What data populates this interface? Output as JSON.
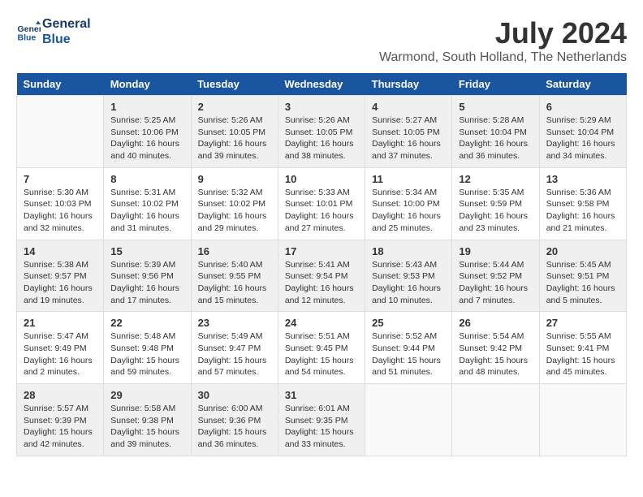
{
  "logo": {
    "line1": "General",
    "line2": "Blue"
  },
  "title": "July 2024",
  "location": "Warmond, South Holland, The Netherlands",
  "weekdays": [
    "Sunday",
    "Monday",
    "Tuesday",
    "Wednesday",
    "Thursday",
    "Friday",
    "Saturday"
  ],
  "weeks": [
    [
      {
        "day": "",
        "info": ""
      },
      {
        "day": "1",
        "info": "Sunrise: 5:25 AM\nSunset: 10:06 PM\nDaylight: 16 hours\nand 40 minutes."
      },
      {
        "day": "2",
        "info": "Sunrise: 5:26 AM\nSunset: 10:05 PM\nDaylight: 16 hours\nand 39 minutes."
      },
      {
        "day": "3",
        "info": "Sunrise: 5:26 AM\nSunset: 10:05 PM\nDaylight: 16 hours\nand 38 minutes."
      },
      {
        "day": "4",
        "info": "Sunrise: 5:27 AM\nSunset: 10:05 PM\nDaylight: 16 hours\nand 37 minutes."
      },
      {
        "day": "5",
        "info": "Sunrise: 5:28 AM\nSunset: 10:04 PM\nDaylight: 16 hours\nand 36 minutes."
      },
      {
        "day": "6",
        "info": "Sunrise: 5:29 AM\nSunset: 10:04 PM\nDaylight: 16 hours\nand 34 minutes."
      }
    ],
    [
      {
        "day": "7",
        "info": "Sunrise: 5:30 AM\nSunset: 10:03 PM\nDaylight: 16 hours\nand 32 minutes."
      },
      {
        "day": "8",
        "info": "Sunrise: 5:31 AM\nSunset: 10:02 PM\nDaylight: 16 hours\nand 31 minutes."
      },
      {
        "day": "9",
        "info": "Sunrise: 5:32 AM\nSunset: 10:02 PM\nDaylight: 16 hours\nand 29 minutes."
      },
      {
        "day": "10",
        "info": "Sunrise: 5:33 AM\nSunset: 10:01 PM\nDaylight: 16 hours\nand 27 minutes."
      },
      {
        "day": "11",
        "info": "Sunrise: 5:34 AM\nSunset: 10:00 PM\nDaylight: 16 hours\nand 25 minutes."
      },
      {
        "day": "12",
        "info": "Sunrise: 5:35 AM\nSunset: 9:59 PM\nDaylight: 16 hours\nand 23 minutes."
      },
      {
        "day": "13",
        "info": "Sunrise: 5:36 AM\nSunset: 9:58 PM\nDaylight: 16 hours\nand 21 minutes."
      }
    ],
    [
      {
        "day": "14",
        "info": "Sunrise: 5:38 AM\nSunset: 9:57 PM\nDaylight: 16 hours\nand 19 minutes."
      },
      {
        "day": "15",
        "info": "Sunrise: 5:39 AM\nSunset: 9:56 PM\nDaylight: 16 hours\nand 17 minutes."
      },
      {
        "day": "16",
        "info": "Sunrise: 5:40 AM\nSunset: 9:55 PM\nDaylight: 16 hours\nand 15 minutes."
      },
      {
        "day": "17",
        "info": "Sunrise: 5:41 AM\nSunset: 9:54 PM\nDaylight: 16 hours\nand 12 minutes."
      },
      {
        "day": "18",
        "info": "Sunrise: 5:43 AM\nSunset: 9:53 PM\nDaylight: 16 hours\nand 10 minutes."
      },
      {
        "day": "19",
        "info": "Sunrise: 5:44 AM\nSunset: 9:52 PM\nDaylight: 16 hours\nand 7 minutes."
      },
      {
        "day": "20",
        "info": "Sunrise: 5:45 AM\nSunset: 9:51 PM\nDaylight: 16 hours\nand 5 minutes."
      }
    ],
    [
      {
        "day": "21",
        "info": "Sunrise: 5:47 AM\nSunset: 9:49 PM\nDaylight: 16 hours\nand 2 minutes."
      },
      {
        "day": "22",
        "info": "Sunrise: 5:48 AM\nSunset: 9:48 PM\nDaylight: 15 hours\nand 59 minutes."
      },
      {
        "day": "23",
        "info": "Sunrise: 5:49 AM\nSunset: 9:47 PM\nDaylight: 15 hours\nand 57 minutes."
      },
      {
        "day": "24",
        "info": "Sunrise: 5:51 AM\nSunset: 9:45 PM\nDaylight: 15 hours\nand 54 minutes."
      },
      {
        "day": "25",
        "info": "Sunrise: 5:52 AM\nSunset: 9:44 PM\nDaylight: 15 hours\nand 51 minutes."
      },
      {
        "day": "26",
        "info": "Sunrise: 5:54 AM\nSunset: 9:42 PM\nDaylight: 15 hours\nand 48 minutes."
      },
      {
        "day": "27",
        "info": "Sunrise: 5:55 AM\nSunset: 9:41 PM\nDaylight: 15 hours\nand 45 minutes."
      }
    ],
    [
      {
        "day": "28",
        "info": "Sunrise: 5:57 AM\nSunset: 9:39 PM\nDaylight: 15 hours\nand 42 minutes."
      },
      {
        "day": "29",
        "info": "Sunrise: 5:58 AM\nSunset: 9:38 PM\nDaylight: 15 hours\nand 39 minutes."
      },
      {
        "day": "30",
        "info": "Sunrise: 6:00 AM\nSunset: 9:36 PM\nDaylight: 15 hours\nand 36 minutes."
      },
      {
        "day": "31",
        "info": "Sunrise: 6:01 AM\nSunset: 9:35 PM\nDaylight: 15 hours\nand 33 minutes."
      },
      {
        "day": "",
        "info": ""
      },
      {
        "day": "",
        "info": ""
      },
      {
        "day": "",
        "info": ""
      }
    ]
  ]
}
